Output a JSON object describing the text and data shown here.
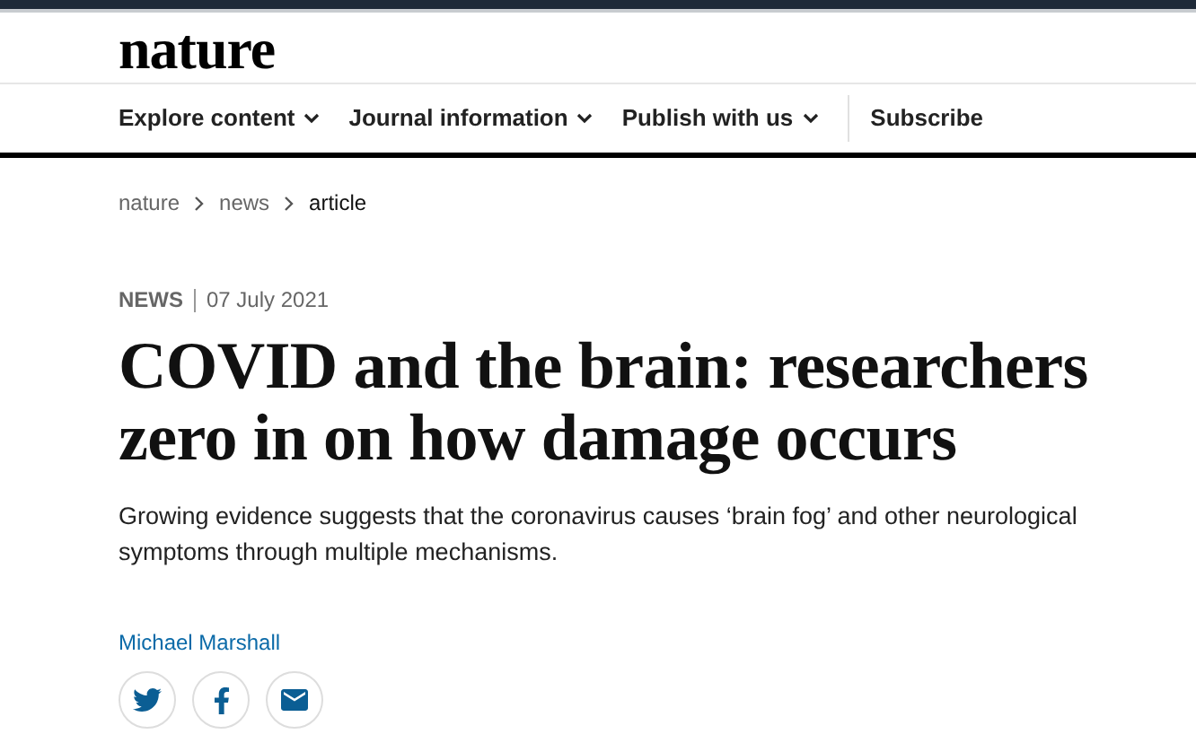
{
  "header": {
    "logo": "nature"
  },
  "nav": {
    "items": [
      {
        "label": "Explore content",
        "kind": "dropdown"
      },
      {
        "label": "Journal information",
        "kind": "dropdown"
      },
      {
        "label": "Publish with us",
        "kind": "dropdown"
      },
      {
        "label": "Subscribe",
        "kind": "link"
      }
    ]
  },
  "breadcrumbs": [
    {
      "label": "nature",
      "current": false
    },
    {
      "label": "news",
      "current": false
    },
    {
      "label": "article",
      "current": true
    }
  ],
  "article": {
    "type": "NEWS",
    "date": "07 July 2021",
    "title": "COVID and the brain: researchers zero in on how damage occurs",
    "summary": "Growing evidence suggests that the coronavirus causes ‘brain fog’ and other neurological symptoms through multiple mechanisms.",
    "author": "Michael Marshall",
    "share": [
      {
        "kind": "twitter"
      },
      {
        "kind": "facebook"
      },
      {
        "kind": "email"
      }
    ]
  }
}
